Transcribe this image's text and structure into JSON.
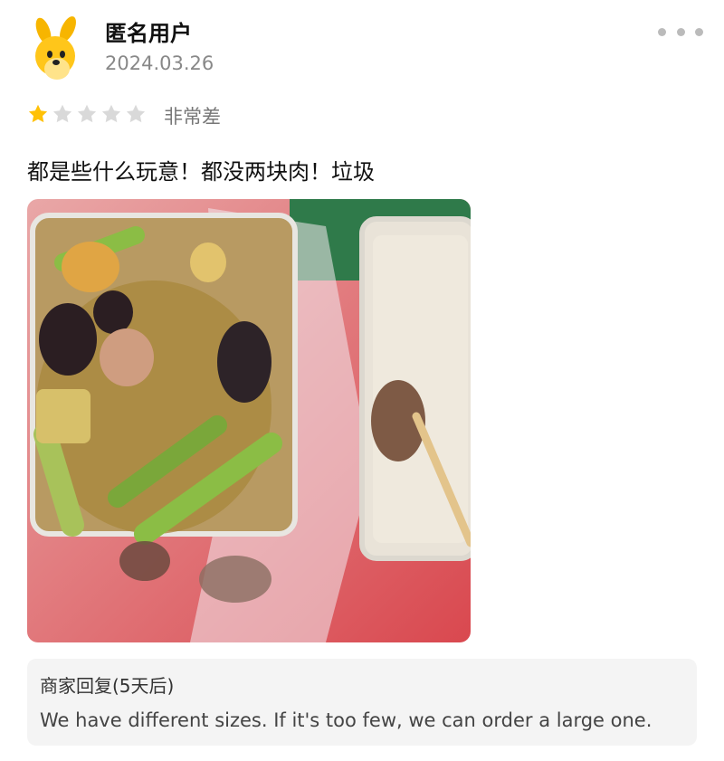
{
  "review": {
    "username": "匿名用户",
    "date": "2024.03.26",
    "rating": 1,
    "rating_max": 5,
    "rating_label": "非常差",
    "text": "都是些什么玩意！都没两块肉！垃圾",
    "photo_icon": "food-photo"
  },
  "merchant_reply": {
    "title": "商家回复(5天后)",
    "text": "We have different sizes. If it's too few, we can order a large one."
  },
  "colors": {
    "star_filled": "#FFC107",
    "star_empty": "#D9D9D9",
    "reply_bg": "#F4F4F4"
  }
}
